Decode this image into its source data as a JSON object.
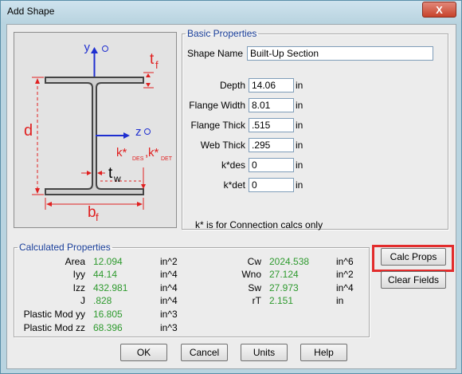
{
  "window": {
    "title": "Add Shape",
    "close_glyph": "X"
  },
  "diagram": {
    "labels": {
      "y_axis": "y",
      "z_axis": "z",
      "tf": "t",
      "tf_sub": "f",
      "d": "d",
      "tw": "t",
      "tw_sub": "w",
      "bf": "b",
      "bf_sub": "f",
      "k1": "k*",
      "k1_sub": "DES",
      "comma": ",",
      "k2": "k*",
      "k2_sub": "DET"
    },
    "colors": {
      "dimension": "#e02020",
      "axis": "#1f2fd0",
      "shape": "#444444",
      "fill": "#cfcfcf"
    }
  },
  "basic": {
    "legend": "Basic Properties",
    "shape_name_label": "Shape Name",
    "shape_name_value": "Built-Up Section",
    "rows": [
      {
        "label": "Depth",
        "value": "14.06",
        "unit": "in"
      },
      {
        "label": "Flange Width",
        "value": "8.01",
        "unit": "in"
      },
      {
        "label": "Flange Thick",
        "value": ".515",
        "unit": "in"
      },
      {
        "label": "Web Thick",
        "value": ".295",
        "unit": "in"
      },
      {
        "label": "k*des",
        "value": "0",
        "unit": "in"
      },
      {
        "label": "k*det",
        "value": "0",
        "unit": "in"
      }
    ],
    "note": "k* is for Connection calcs only"
  },
  "calculated": {
    "legend": "Calculated Properties",
    "left": [
      {
        "label": "Area",
        "value": "12.094",
        "unit": "in^2"
      },
      {
        "label": "Iyy",
        "value": "44.14",
        "unit": "in^4"
      },
      {
        "label": "Izz",
        "value": "432.981",
        "unit": "in^4"
      },
      {
        "label": "J",
        "value": ".828",
        "unit": "in^4"
      },
      {
        "label": "Plastic Mod yy",
        "value": "16.805",
        "unit": "in^3"
      },
      {
        "label": "Plastic Mod zz",
        "value": "68.396",
        "unit": "in^3"
      }
    ],
    "right": [
      {
        "label": "Cw",
        "value": "2024.538",
        "unit": "in^6"
      },
      {
        "label": "Wno",
        "value": "27.124",
        "unit": "in^2"
      },
      {
        "label": "Sw",
        "value": "27.973",
        "unit": "in^4"
      },
      {
        "label": "rT",
        "value": "2.151",
        "unit": "in"
      }
    ]
  },
  "buttons": {
    "calc_props": "Calc Props",
    "clear_fields": "Clear Fields",
    "ok": "OK",
    "cancel": "Cancel",
    "units": "Units",
    "help": "Help"
  },
  "colors": {
    "highlight": "#e22c2c",
    "value_green": "#2e9a2e",
    "legend_blue": "#1a3f9a"
  }
}
